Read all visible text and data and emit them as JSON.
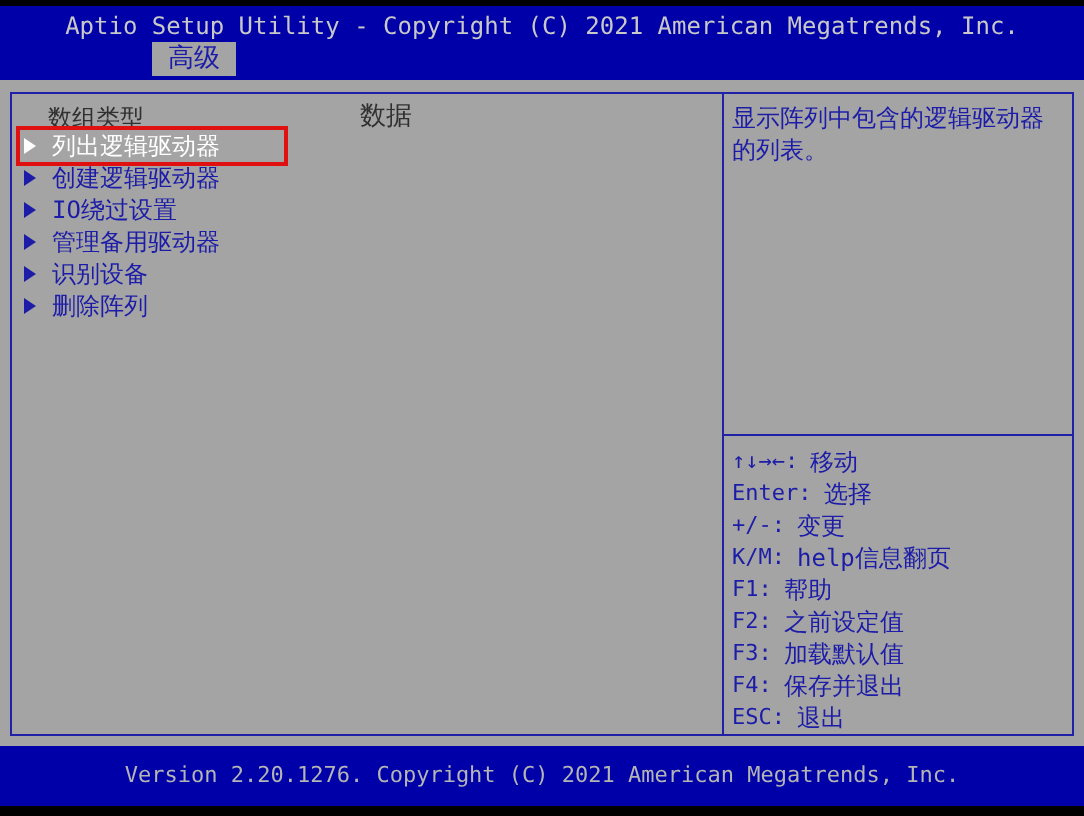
{
  "window": {
    "title": "Aptio Setup Utility - Copyright (C) 2021 American Megatrends, Inc."
  },
  "tabs": [
    {
      "label": "高级",
      "selected": true
    }
  ],
  "main": {
    "column_headers": [
      "数组类型",
      "数据"
    ],
    "items": [
      {
        "label": "列出逻辑驱动器",
        "selected": true
      },
      {
        "label": "创建逻辑驱动器",
        "selected": false
      },
      {
        "label": "IO绕过设置",
        "selected": false
      },
      {
        "label": "管理备用驱动器",
        "selected": false
      },
      {
        "label": "识别设备",
        "selected": false
      },
      {
        "label": "删除阵列",
        "selected": false
      }
    ]
  },
  "help": {
    "description": "显示阵列中包含的逻辑驱动器的列表。",
    "keys": [
      {
        "key": "↑↓→←:",
        "action": "移动"
      },
      {
        "key": "Enter:",
        "action": "选择"
      },
      {
        "key": "+/-:",
        "action": "变更"
      },
      {
        "key": "K/M:",
        "action": "help信息翻页"
      },
      {
        "key": "F1:",
        "action": "帮助"
      },
      {
        "key": "F2:",
        "action": "之前设定值"
      },
      {
        "key": "F3:",
        "action": "加载默认值"
      },
      {
        "key": "F4:",
        "action": "保存并退出"
      },
      {
        "key": "ESC:",
        "action": "退出"
      }
    ]
  },
  "status_bar": "Version 2.20.1276. Copyright (C) 2021 American Megatrends, Inc."
}
